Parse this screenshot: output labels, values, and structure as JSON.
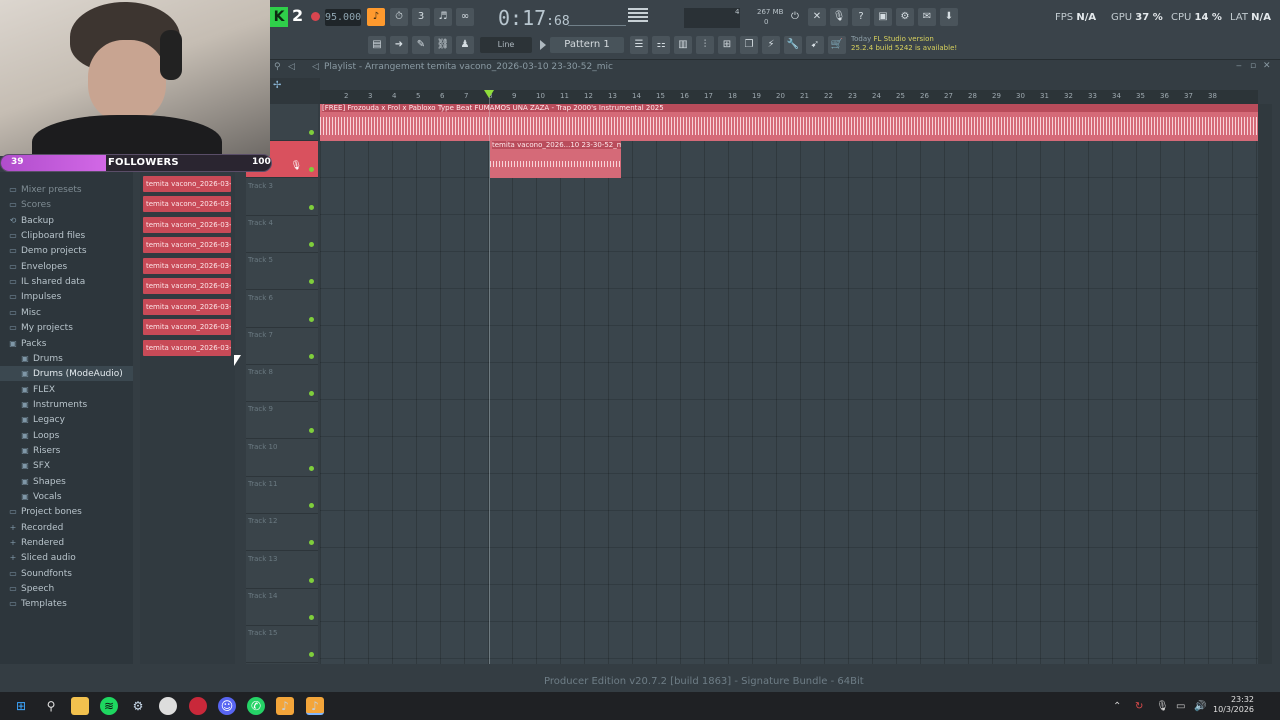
{
  "toolbar": {
    "badge": "2",
    "tempo": "95.000",
    "time_main": "0:17",
    "time_sub": ":68",
    "mem_top": "4",
    "mem_mb": "267 MB",
    "mem_bottom": "0",
    "line_mode": "Line",
    "pattern": "Pattern 1",
    "fps_label": "FPS",
    "fps_value": "N/A",
    "gpu_label": "GPU",
    "gpu_value": "37 %",
    "cpu_label": "CPU",
    "cpu_value": "14 %",
    "lat_label": "LAT",
    "lat_value": "N/A",
    "news_line1_a": "Today",
    "news_line1_b": "FL Studio version",
    "news_line2": "25.2.4 build 5242 is available!",
    "colors": {
      "accent": "#ff9a2e",
      "green": "#8fdd3b"
    }
  },
  "overlay": {
    "followers_count": "39",
    "followers_label": "FOLLOWERS",
    "followers_goal": "100",
    "followers_progress": 0.39
  },
  "browser": {
    "items": [
      {
        "label": "Mixer presets",
        "icon": "folder-icon"
      },
      {
        "label": "Scores",
        "icon": "folder-icon"
      },
      {
        "label": "Backup",
        "icon": "backup-icon"
      },
      {
        "label": "Clipboard files",
        "icon": "folder-icon"
      },
      {
        "label": "Demo projects",
        "icon": "folder-icon"
      },
      {
        "label": "Envelopes",
        "icon": "folder-icon"
      },
      {
        "label": "IL shared data",
        "icon": "folder-icon"
      },
      {
        "label": "Impulses",
        "icon": "folder-icon"
      },
      {
        "label": "Misc",
        "icon": "folder-icon"
      },
      {
        "label": "My projects",
        "icon": "folder-icon"
      },
      {
        "label": "Packs",
        "icon": "pack-icon"
      },
      {
        "label": "Drums",
        "icon": "pack-icon"
      },
      {
        "label": "Drums (ModeAudio)",
        "icon": "pack-icon"
      },
      {
        "label": "FLEX",
        "icon": "pack-icon"
      },
      {
        "label": "Instruments",
        "icon": "pack-icon"
      },
      {
        "label": "Legacy",
        "icon": "pack-icon"
      },
      {
        "label": "Loops",
        "icon": "pack-icon"
      },
      {
        "label": "Risers",
        "icon": "pack-icon"
      },
      {
        "label": "SFX",
        "icon": "pack-icon"
      },
      {
        "label": "Shapes",
        "icon": "pack-icon"
      },
      {
        "label": "Vocals",
        "icon": "pack-icon"
      },
      {
        "label": "Project bones",
        "icon": "folder-icon"
      },
      {
        "label": "Recorded",
        "icon": "plus-icon"
      },
      {
        "label": "Rendered",
        "icon": "plus-icon"
      },
      {
        "label": "Sliced audio",
        "icon": "plus-icon"
      },
      {
        "label": "Soundfonts",
        "icon": "folder-icon"
      },
      {
        "label": "Speech",
        "icon": "folder-icon"
      },
      {
        "label": "Templates",
        "icon": "folder-icon"
      }
    ]
  },
  "clips": {
    "items": [
      "temita vacono_2026-03-",
      "temita vacono_2026-03-",
      "temita vacono_2026-03-",
      "temita vacono_2026-03-",
      "temita vacono_2026-03-",
      "temita vacono_2026-03-",
      "temita vacono_2026-03-",
      "temita vacono_2026-03-",
      "temita vacono_2026-03-",
      "temita vacono_2026-03-"
    ]
  },
  "playlist": {
    "title": "Playlist - Arrangement",
    "subtitle": "temita vacono_2026-03-10 23-30-52_mic",
    "beat_clip_title": "[FREE] Frozouda x Frol x Pabloxo Type Beat FUMAMOS UNA ZAZA - Trap 2000's Instrumental 2025",
    "mic_clip_title": "temita vacono_2026...10 23-30-52_mic",
    "ruler": [
      "2",
      "3",
      "4",
      "5",
      "6",
      "7",
      "8",
      "9",
      "10",
      "11",
      "12",
      "13",
      "14",
      "15",
      "16",
      "17",
      "18",
      "19",
      "20",
      "21",
      "22",
      "23",
      "24",
      "25",
      "26",
      "27",
      "28",
      "29",
      "30",
      "31",
      "32",
      "33",
      "34",
      "35",
      "36",
      "37",
      "38"
    ],
    "tracks": [
      "1",
      "",
      "Track 3",
      "Track 4",
      "Track 5",
      "Track 6",
      "Track 7",
      "Track 8",
      "Track 9",
      "Track 10",
      "Track 11",
      "Track 12",
      "Track 13",
      "Track 14",
      "Track 15"
    ]
  },
  "status": {
    "text": "Producer Edition v20.7.2 [build 1863] - Signature Bundle - 64Bit"
  },
  "taskbar": {
    "time": "23:32",
    "date": "10/3/2026"
  }
}
